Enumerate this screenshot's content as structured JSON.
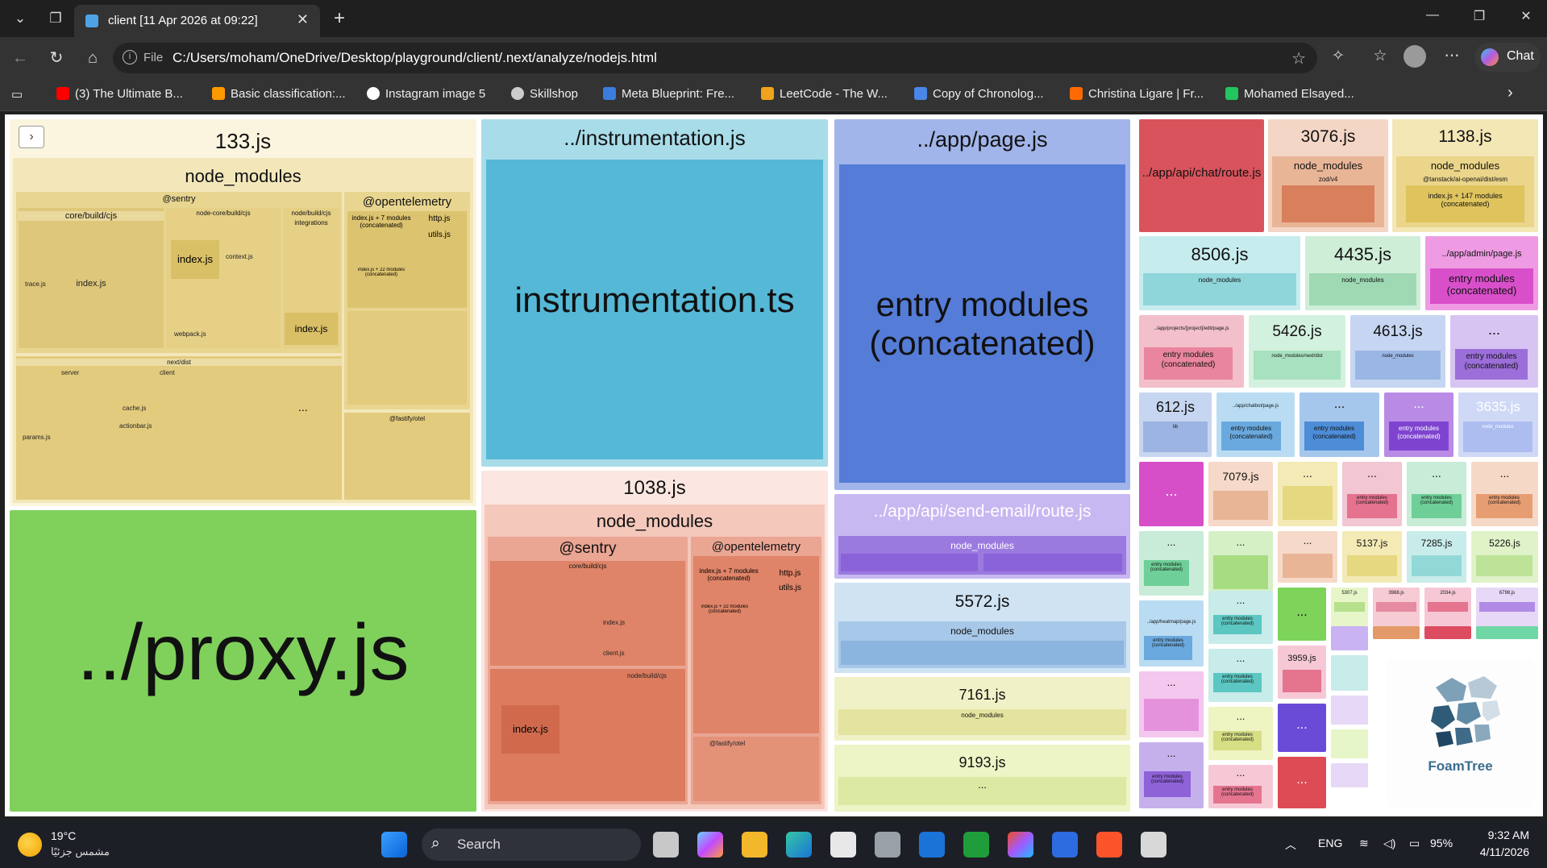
{
  "browser": {
    "tab_title": "client [11 Apr 2026 at 09:22]",
    "url_scheme": "File",
    "url": "C:/Users/moham/OneDrive/Desktop/playground/client/.next/analyze/nodejs.html",
    "chat_label": "Chat"
  },
  "bookmarks": [
    {
      "label": "(3) The Ultimate B...",
      "color": "#ff0000"
    },
    {
      "label": "Basic classification:...",
      "color": "#ff9900"
    },
    {
      "label": "Instagram image 5",
      "color": "#ffffff"
    },
    {
      "label": "Skillshop",
      "color": "#cccccc"
    },
    {
      "label": "Meta Blueprint: Fre...",
      "color": "#3b7ddd"
    },
    {
      "label": "LeetCode - The W...",
      "color": "#f0a41b"
    },
    {
      "label": "Copy of Chronolog...",
      "color": "#4a86e8"
    },
    {
      "label": "Christina Ligare | Fr...",
      "color": "#ff6a00"
    },
    {
      "label": "Mohamed Elsayed...",
      "color": "#22c55e"
    }
  ],
  "treemap": {
    "proxy": "../proxy.js",
    "chunk133": {
      "title": "133.js",
      "node_modules": "node_modules",
      "sentry": "@sentry",
      "opentelemetry": "@opentelemetry",
      "core_build": "core/build/cjs",
      "node_core": "node-core/build/cjs",
      "node_build": "node/build/cjs",
      "integrations": "integrations",
      "index_js": "index.js",
      "utils_js": "utils.js",
      "trace_js": "trace.js",
      "context_js": "context.js",
      "webpack_js": "webpack.js",
      "next_dist": "next/dist",
      "server": "server",
      "client": "client",
      "cache_js": "cache.js",
      "actionbar_js": "actionbar.js",
      "params_js": "params.js",
      "index_concat": "index.js + 7 modules (concatenated)",
      "index_concat22": "index.js + 22 modules (concatenated)",
      "http_js": "http.js",
      "fastify": "@fastify/otel",
      "ellipsis": "..."
    },
    "instrumentation": {
      "title": "../instrumentation.js",
      "inner": "instrumentation.ts"
    },
    "app_page": {
      "title": "../app/page.js",
      "inner": "entry modules (concatenated)"
    },
    "chunk1038": {
      "title": "1038.js",
      "node_modules": "node_modules",
      "sentry": "@sentry",
      "opentelemetry": "@opentelemetry",
      "core_build": "core/build/cjs",
      "node_build": "node/build/cjs",
      "index_js": "index.js",
      "client_js": "client.js",
      "http_js": "http.js",
      "utils_js": "utils.js",
      "index_concat": "index.js + 7 modules (concatenated)",
      "index_concat22": "index.js + 22 modules (concatenated)",
      "fastify": "@fastify/otel",
      "ellipsis": "..."
    },
    "send_email": {
      "title": "../app/api/send-email/route.js",
      "node_modules": "node_modules"
    },
    "chunk5572": {
      "title": "5572.js",
      "node_modules": "node_modules"
    },
    "chunk7161": {
      "title": "7161.js",
      "node_modules": "node_modules"
    },
    "chunk9193": {
      "title": "9193.js"
    },
    "chat_route": {
      "title": "../app/api/chat/route.js"
    },
    "chunk3076": {
      "title": "3076.js",
      "node_modules": "node_modules",
      "zod": "zod/v4"
    },
    "chunk1138": {
      "title": "1138.js",
      "node_modules": "node_modules",
      "tanstack": "@tanstack/ai-openai/dist/esm",
      "concat": "index.js + 147 modules (concatenated)"
    },
    "chunk8506": {
      "title": "8506.js",
      "node_modules": "node_modules"
    },
    "chunk4435": {
      "title": "4435.js",
      "node_modules": "node_modules"
    },
    "admin_page": {
      "title": "../app/admin/page.js",
      "inner": "entry modules (concatenated)"
    },
    "projects_page": {
      "title": "../app/projects/[project]/edit/page.js",
      "inner": "entry modules (concatenated)"
    },
    "chunk5426": {
      "title": "5426.js",
      "node_modules": "node_modules/next/dist"
    },
    "chunk4613": {
      "title": "4613.js",
      "node_modules": "node_modules"
    },
    "purple_entry": {
      "title": "...",
      "inner": "entry modules (concatenated)"
    },
    "chunk612": {
      "title": "612.js",
      "lib": "lib"
    },
    "chatbot_page": {
      "title": "../app/chatbot/page.js",
      "inner": "entry modules (concatenated)"
    },
    "blue_entry": {
      "title": "...",
      "inner": "entry modules (concatenated)"
    },
    "violet_entry": {
      "title": "...",
      "inner": "entry modules (concatenated)"
    },
    "chunk3635": {
      "title": "3635.js",
      "node_modules": "node_modules"
    },
    "chunk7079": {
      "title": "7079.js"
    },
    "chunk5137": {
      "title": "5137.js"
    },
    "chunk7285": {
      "title": "7285.js"
    },
    "chunk5226": {
      "title": "5226.js"
    },
    "chunk3959": {
      "title": "3959.js"
    },
    "chunk5307": {
      "title": "5307.js"
    },
    "chunk3988": {
      "title": "3988.js"
    },
    "chunk2034": {
      "title": "2034.js"
    },
    "chunk6798": {
      "title": "6798.js"
    },
    "heatmap_page": {
      "title": "../app/heatmap/page.js",
      "inner": "entry modules (concatenated)"
    },
    "entry_concat": "entry modules (concatenated)",
    "ellipsis": "...",
    "foamtree": "FoamTree"
  },
  "taskbar": {
    "temperature": "19°C",
    "weather_desc": "مشمس جزئيًا",
    "search_label": "Search",
    "language": "ENG",
    "battery": "95%",
    "time": "9:32 AM",
    "date": "4/11/2026"
  }
}
